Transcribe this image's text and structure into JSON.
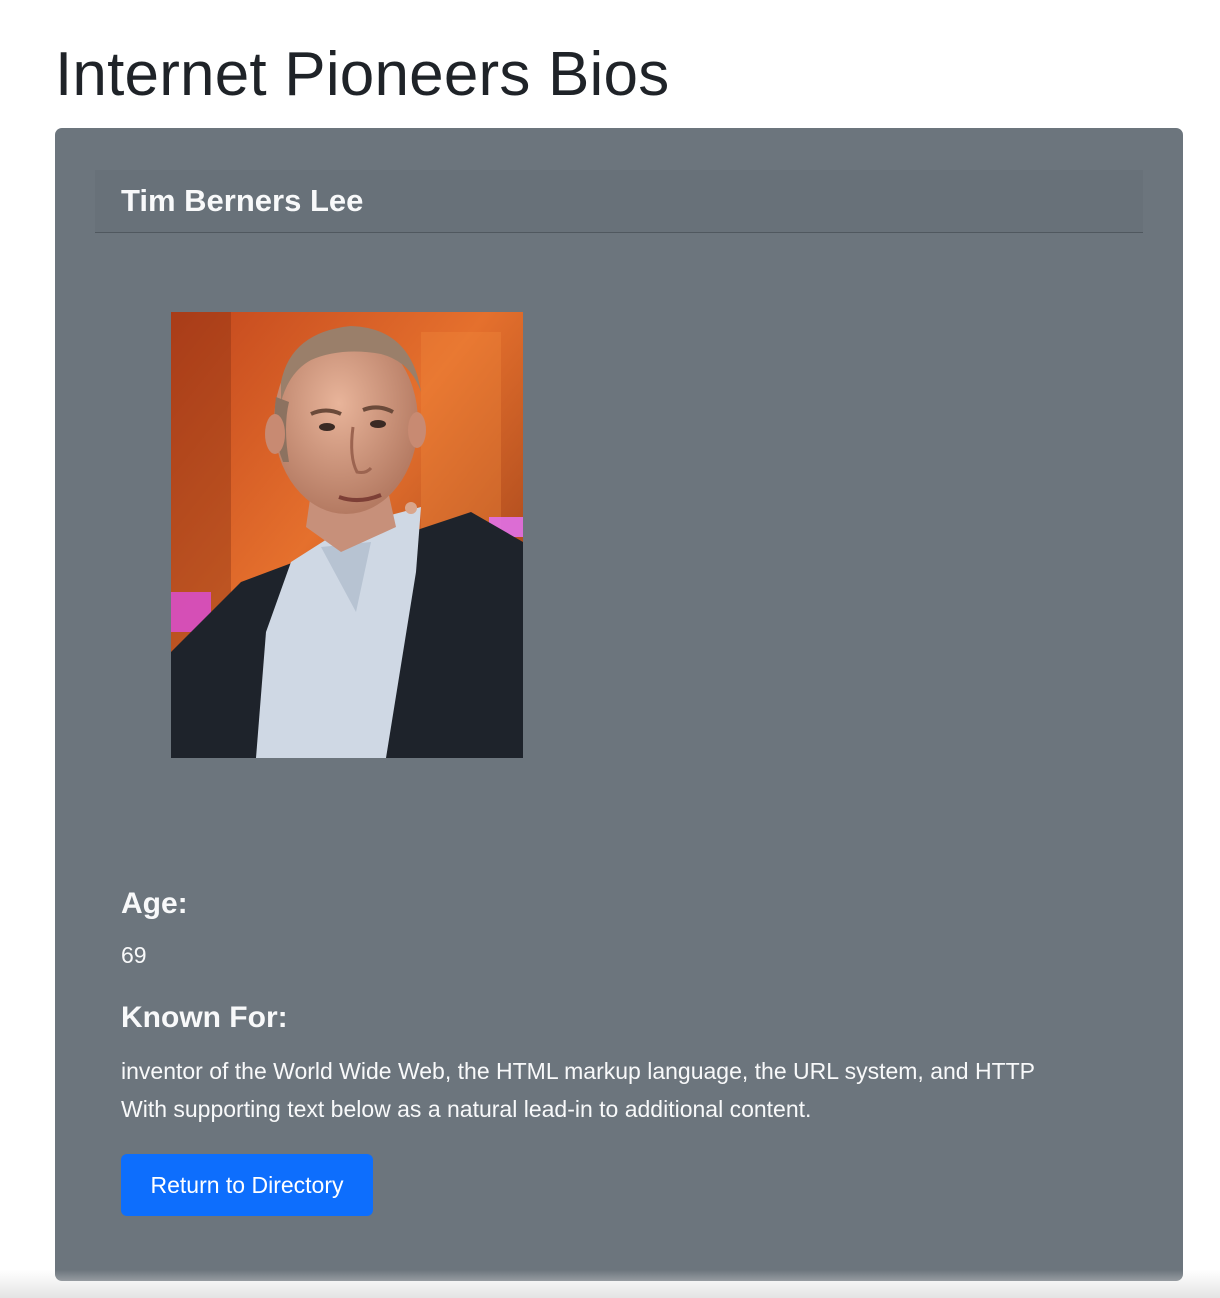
{
  "page": {
    "title": "Internet Pioneers Bios"
  },
  "card": {
    "header_title": "Tim Berners Lee",
    "photo_alt": "Tim Berners Lee",
    "age_label": "Age:",
    "age_value": "69",
    "known_for_label": "Known For:",
    "known_for_line1": "inventor of the World Wide Web, the HTML markup language, the URL system, and HTTP",
    "known_for_line2": "With supporting text below as a natural lead-in to additional content.",
    "return_button_label": "Return to Directory"
  },
  "colors": {
    "card_background": "#6c757d",
    "button_primary": "#0d6efd",
    "text_light": "#f8f9fa"
  }
}
